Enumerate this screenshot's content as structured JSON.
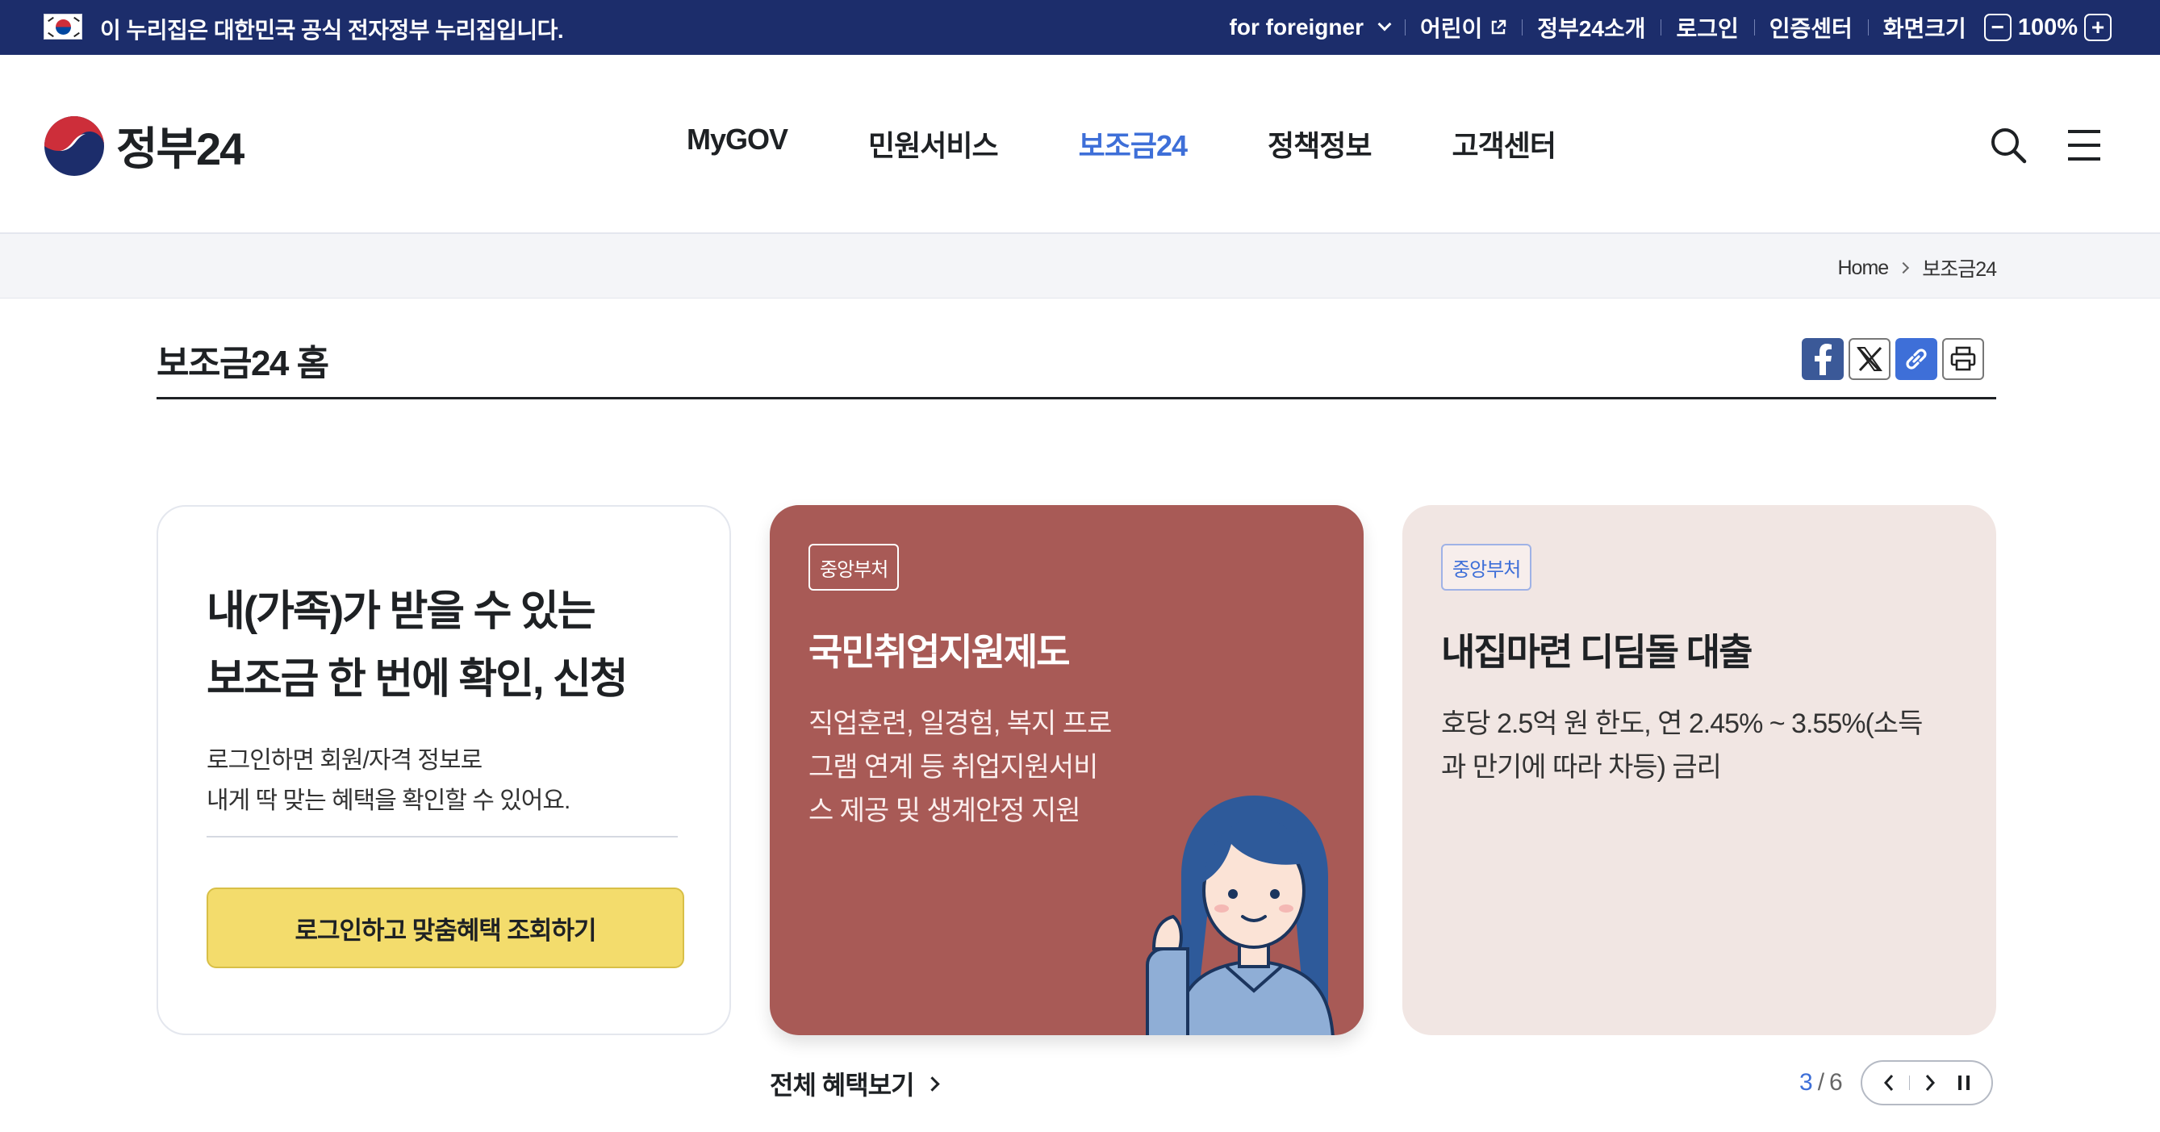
{
  "gov_banner": {
    "notice": "이 누리집은 대한민국 공식 전자정부 누리집입니다.",
    "util_links": [
      "for foreigner",
      "어린이",
      "정부24소개",
      "로그인",
      "인증센터",
      "화면크기"
    ],
    "zoom": "100%",
    "zoom_minus": "−",
    "zoom_plus": "+"
  },
  "header": {
    "logo_text": "정부24",
    "nav": [
      "MyGOV",
      "민원서비스",
      "보조금24",
      "정책정보",
      "고객센터"
    ]
  },
  "breadcrumb": {
    "home": "Home",
    "current": "보조금24"
  },
  "page": {
    "title": "보조금24 홈"
  },
  "login_card": {
    "headline_line1": "내(가족)가 받을 수 있는",
    "headline_line2": "보조금 한 번에 확인, 신청",
    "desc_line1": "로그인하면 회원/자격 정보로",
    "desc_line2": "내게 딱 맞는 혜택을 확인할 수 있어요.",
    "cta": "로그인하고 맞춤혜택 조회하기"
  },
  "promos": [
    {
      "tag": "중앙부처",
      "title": "국민취업지원제도",
      "desc_lines": [
        "직업훈련, 일경험, 복지 프로",
        "그램 연계 등 취업지원서비",
        "스 제공 및 생계안정 지원"
      ]
    },
    {
      "tag": "중앙부처",
      "title": "내집마련 디딤돌 대출",
      "desc_lines": [
        "호당 2.5억 원 한도, 연 2.45% ~ 3.55%(소득",
        "과 만기에 따라 차등) 금리"
      ]
    }
  ],
  "footer_controls": {
    "all_link": "전체 혜택보기",
    "current_page": "3",
    "separator": "/",
    "total_pages": "6"
  },
  "colors": {
    "gov_bar": "#1c2d6b",
    "accent": "#3e6fd8",
    "promo_red": "#a85a56",
    "promo_pink": "#f1e6e3",
    "cta_yellow": "#f3dc6c"
  }
}
